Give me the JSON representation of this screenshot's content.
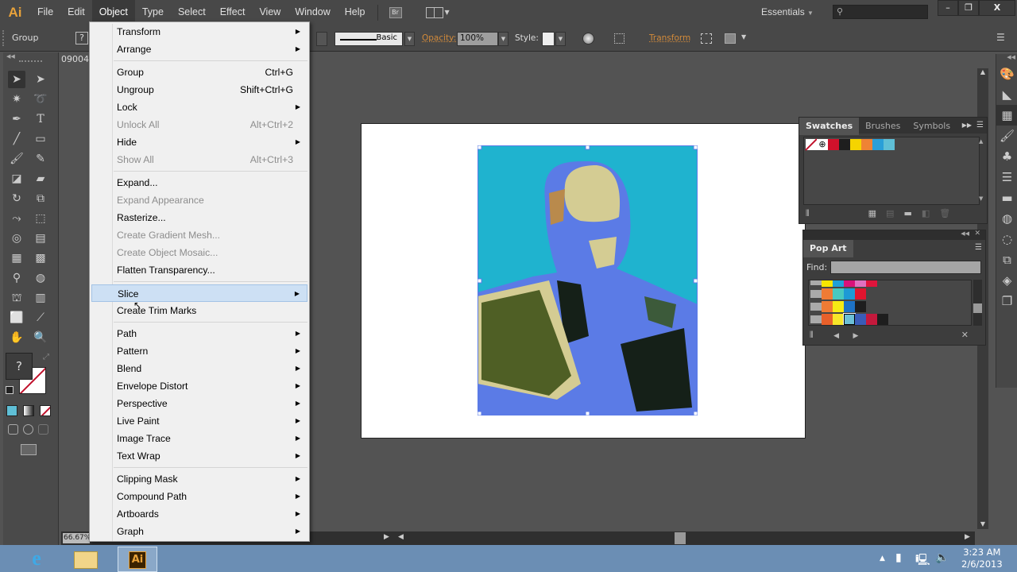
{
  "app": {
    "logo": "Ai",
    "title": "Adobe Illustrator"
  },
  "menubar": {
    "items": [
      "File",
      "Edit",
      "Object",
      "Type",
      "Select",
      "Effect",
      "View",
      "Window",
      "Help"
    ],
    "active": "Object",
    "bridge_label": "Br",
    "workspace": "Essentials",
    "search_placeholder": ""
  },
  "window_controls": {
    "minimize": "–",
    "restore": "❐",
    "close": "X"
  },
  "control_bar": {
    "selection_label": "Group",
    "fill_unknown": "?",
    "stroke_profile": "Basic",
    "opacity_label": "Opacity:",
    "opacity_value": "100%",
    "style_label": "Style:",
    "transform_link": "Transform"
  },
  "document": {
    "tab_name": "09004",
    "zoom": "66.67%"
  },
  "object_menu": {
    "items": [
      {
        "label": "Transform",
        "submenu": true
      },
      {
        "label": "Arrange",
        "submenu": true
      },
      {
        "sep": true
      },
      {
        "label": "Group",
        "shortcut": "Ctrl+G"
      },
      {
        "label": "Ungroup",
        "shortcut": "Shift+Ctrl+G"
      },
      {
        "label": "Lock",
        "submenu": true
      },
      {
        "label": "Unlock All",
        "shortcut": "Alt+Ctrl+2",
        "disabled": true
      },
      {
        "label": "Hide",
        "submenu": true
      },
      {
        "label": "Show All",
        "shortcut": "Alt+Ctrl+3",
        "disabled": true
      },
      {
        "sep": true
      },
      {
        "label": "Expand..."
      },
      {
        "label": "Expand Appearance",
        "disabled": true
      },
      {
        "label": "Rasterize..."
      },
      {
        "label": "Create Gradient Mesh...",
        "disabled": true
      },
      {
        "label": "Create Object Mosaic...",
        "disabled": true
      },
      {
        "label": "Flatten Transparency..."
      },
      {
        "sep": true
      },
      {
        "label": "Slice",
        "submenu": true,
        "highlighted": true
      },
      {
        "label": "Create Trim Marks"
      },
      {
        "sep": true
      },
      {
        "label": "Path",
        "submenu": true
      },
      {
        "label": "Pattern",
        "submenu": true
      },
      {
        "label": "Blend",
        "submenu": true
      },
      {
        "label": "Envelope Distort",
        "submenu": true
      },
      {
        "label": "Perspective",
        "submenu": true
      },
      {
        "label": "Live Paint",
        "submenu": true
      },
      {
        "label": "Image Trace",
        "submenu": true
      },
      {
        "label": "Text Wrap",
        "submenu": true
      },
      {
        "sep": true
      },
      {
        "label": "Clipping Mask",
        "submenu": true
      },
      {
        "label": "Compound Path",
        "submenu": true
      },
      {
        "label": "Artboards",
        "submenu": true
      },
      {
        "label": "Graph",
        "submenu": true
      }
    ]
  },
  "swatches_panel": {
    "tabs": [
      "Swatches",
      "Brushes",
      "Symbols"
    ],
    "active_tab": "Swatches",
    "swatches": [
      "none",
      "registration",
      "#d0112b",
      "#1e1e1e",
      "#f5d400",
      "#ef8334",
      "#2a9fd8",
      "#5fbfd6"
    ]
  },
  "pop_art_panel": {
    "title": "Pop Art",
    "find_label": "Find:",
    "find_value": "",
    "rows": [
      [
        "#f7e600",
        "#1fa0d8",
        "#d9117a",
        "#e070c0",
        "#e0143c"
      ],
      [
        "#ef7b34",
        "#47c9c0",
        "#1d9ad6",
        "#e0142e"
      ],
      [
        "#ef7b34",
        "#f6eb14",
        "#1d72c4",
        "#1e1e1e"
      ],
      [
        "#e8602a",
        "#f7e629",
        "#6cbfd6",
        "#3a5cb8",
        "#c4193c",
        "#1e1e1e"
      ]
    ],
    "selected_swatch": "#6cbfd6"
  },
  "artwork": {
    "colors": {
      "background": "#1fb3cf",
      "skin": "#d4cc93",
      "tan": "#b98a4c",
      "blue": "#5b7be6",
      "dark": "#152018",
      "olive": "#4f5f25",
      "green": "#3c5a3a"
    }
  },
  "taskbar": {
    "apps": [
      "Internet Explorer",
      "File Explorer",
      "Adobe Illustrator"
    ],
    "active_app": "Adobe Illustrator",
    "ai_label": "Ai",
    "time": "3:23 AM",
    "date": "2/6/2013"
  }
}
